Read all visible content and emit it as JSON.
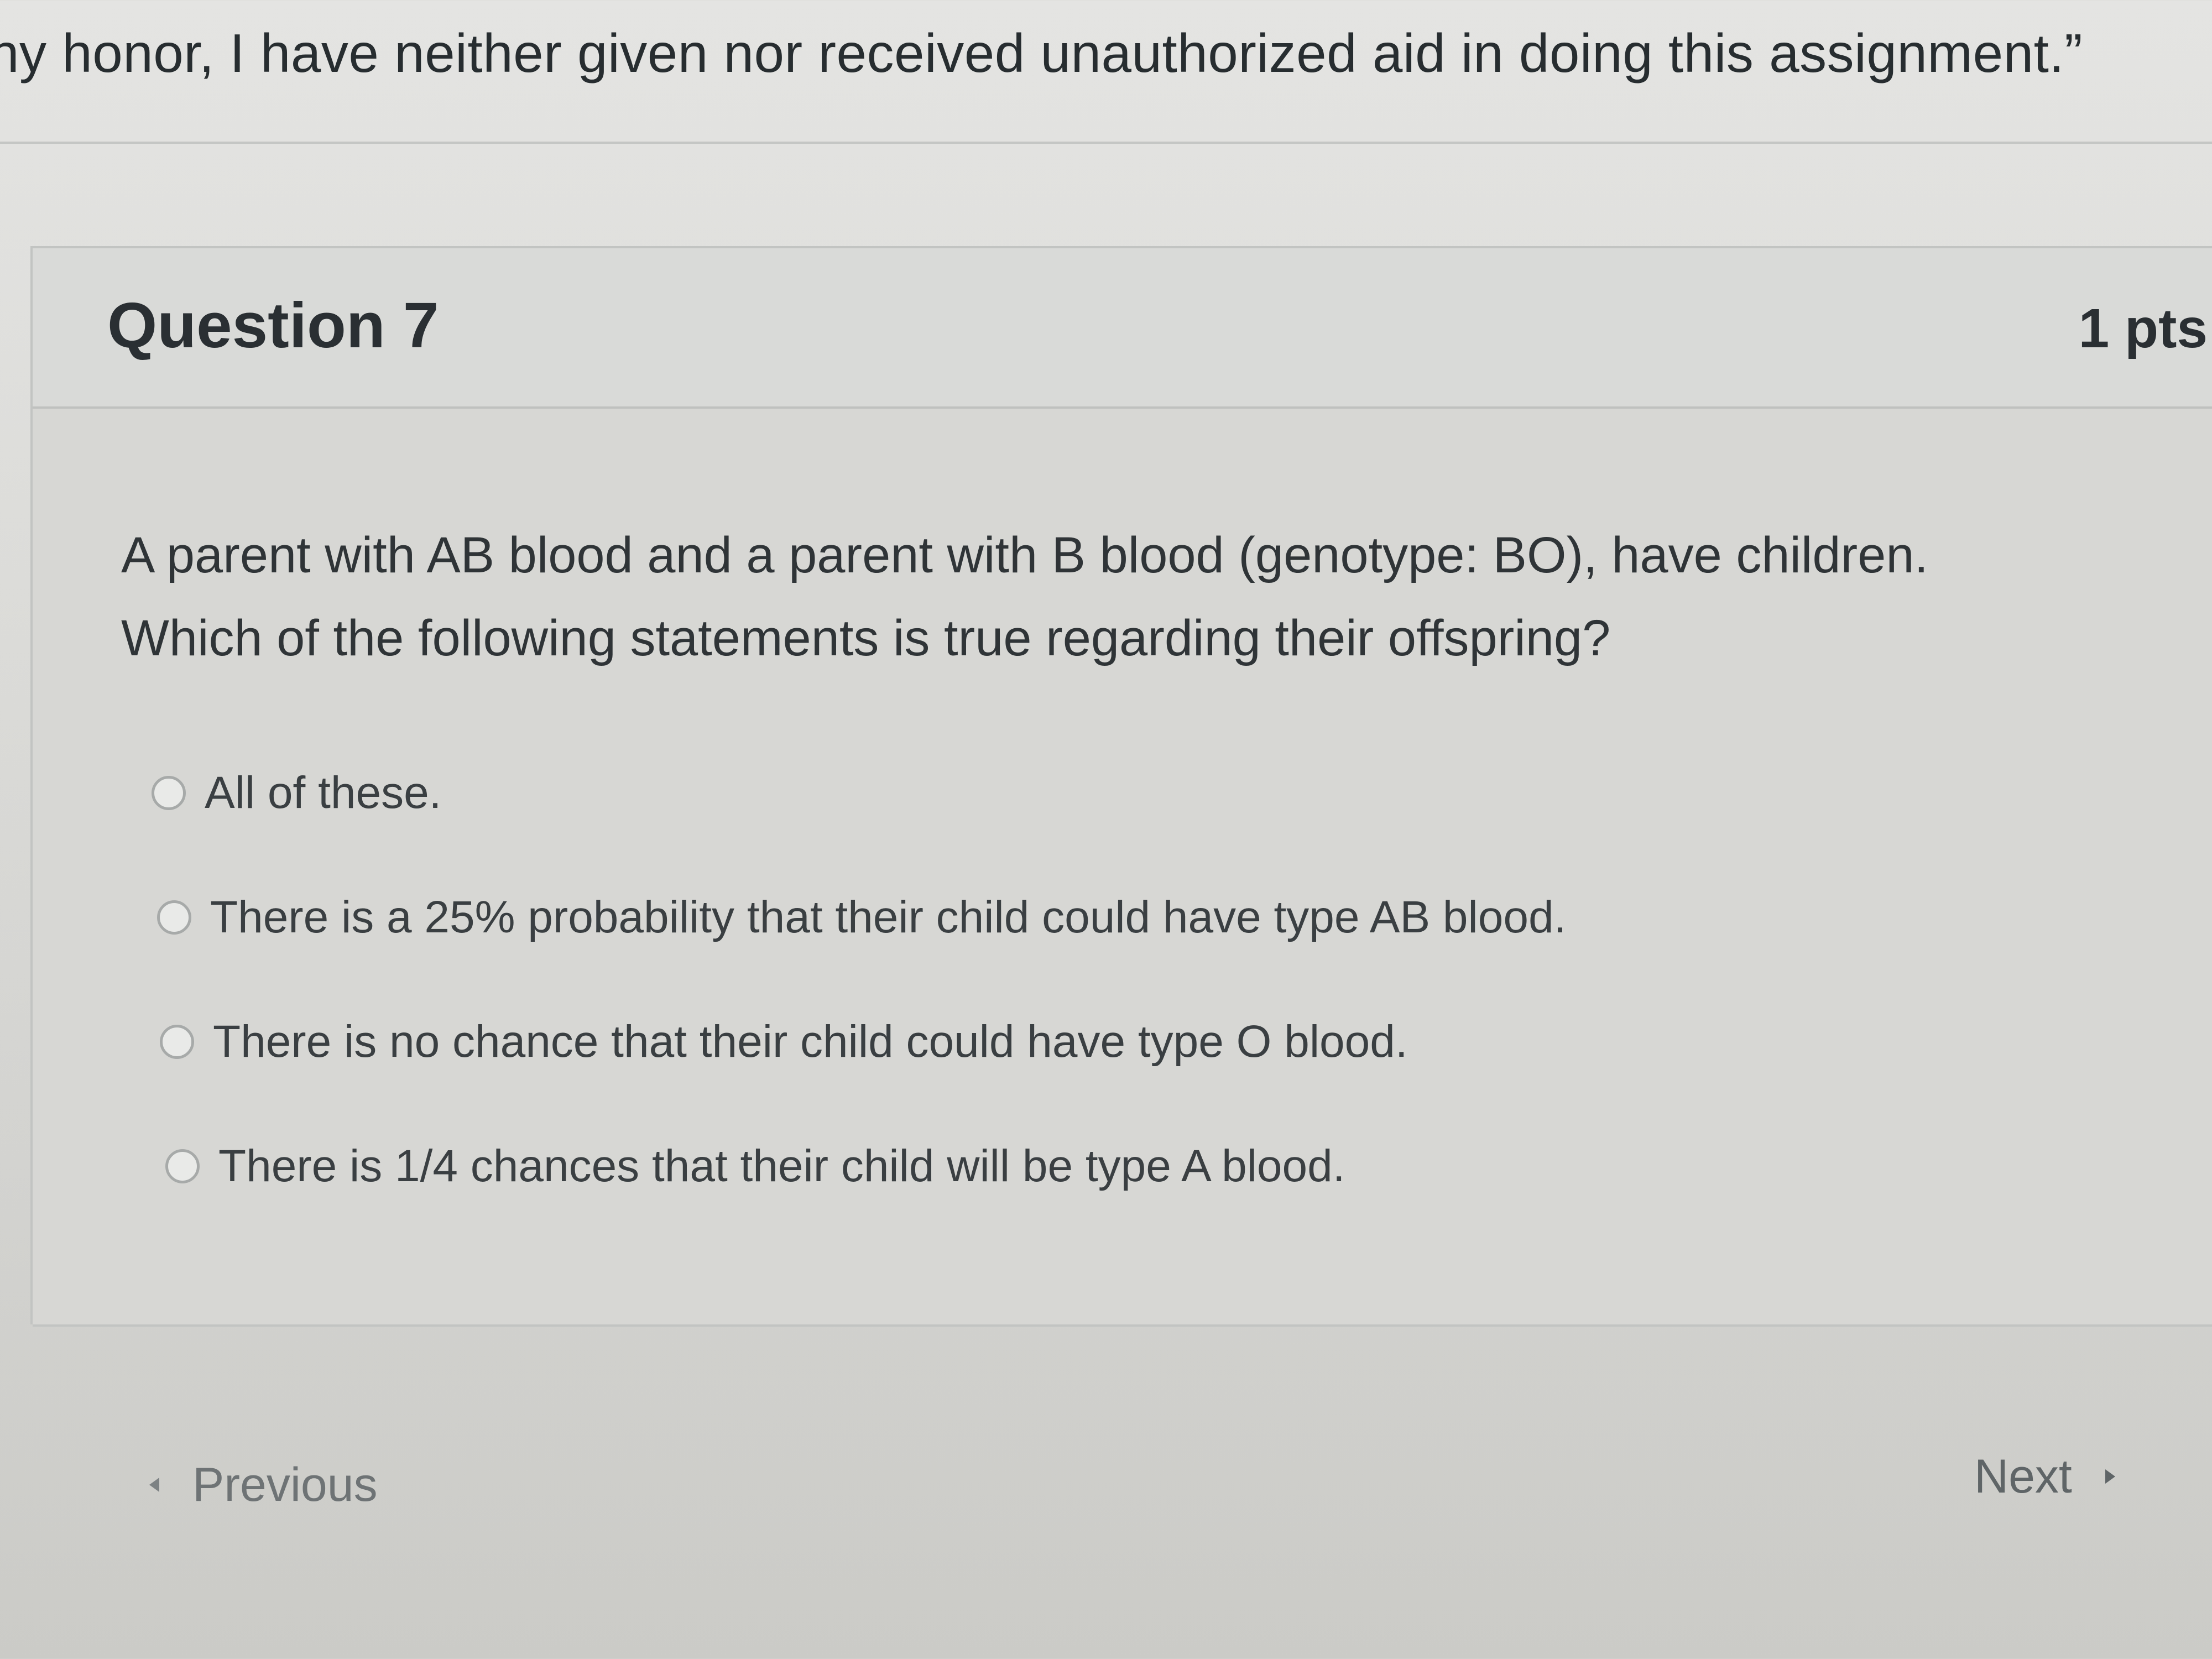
{
  "honor_statement": "ny honor, I have neither given nor received unauthorized aid in doing this assignment.”",
  "question": {
    "title": "Question 7",
    "points": "1 pts",
    "text_line1": "A parent with AB blood and a parent with B blood (genotype: BO), have children.",
    "text_line2": "Which of the following statements is true regarding their offspring?",
    "answers": [
      "All of these.",
      "There is a 25% probability that their child could have type AB blood.",
      "There is no chance that their child could have type O blood.",
      "There is 1/4 chances that their child will be type A blood."
    ]
  },
  "navigation": {
    "previous_label": "Previous",
    "next_label": "Next"
  }
}
